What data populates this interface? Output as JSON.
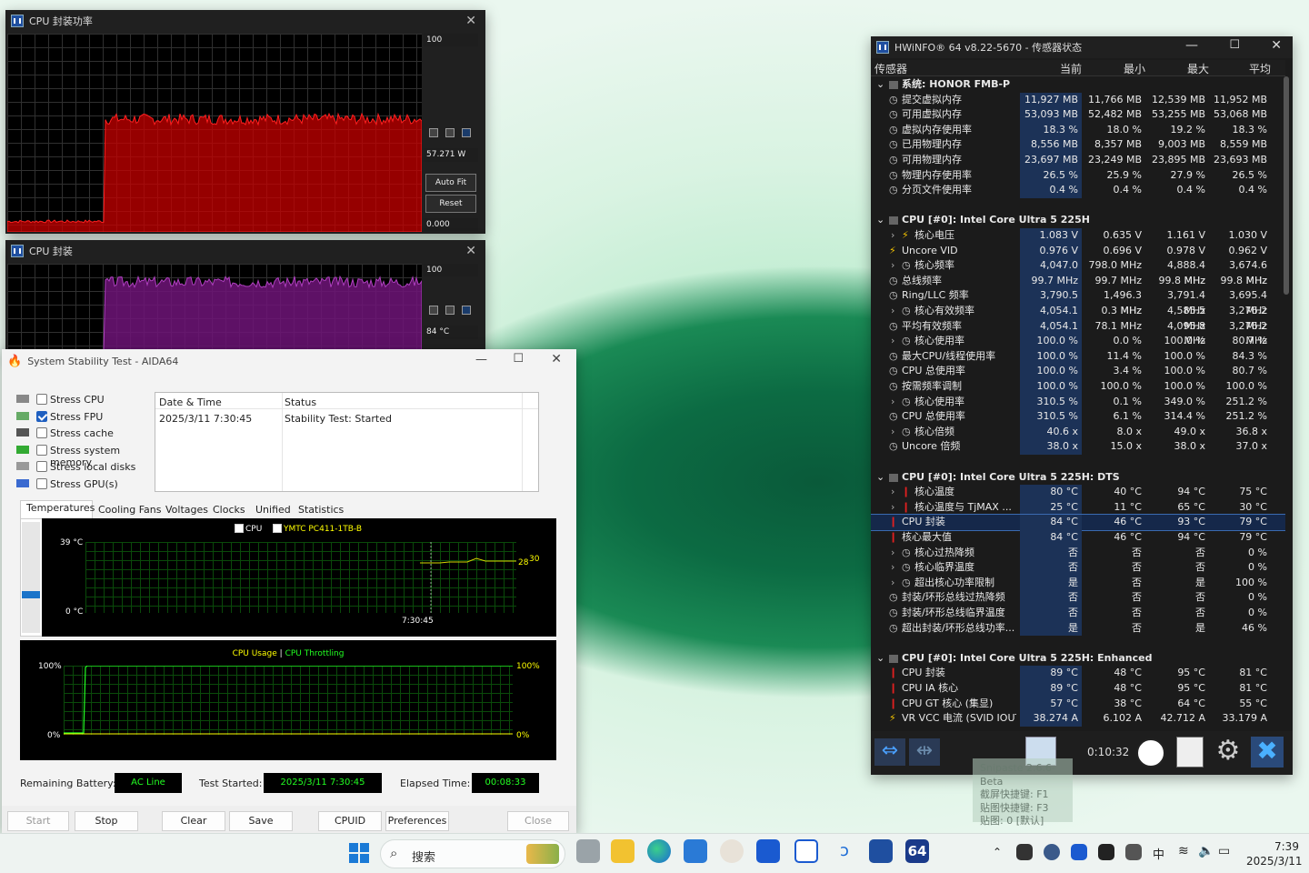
{
  "power_window": {
    "title": "CPU 封装功率",
    "scale_top": "100",
    "current": "57.271 W",
    "auto_fit": "Auto Fit",
    "reset": "Reset",
    "scale_bottom": "0.000"
  },
  "pkg_window": {
    "title": "CPU 封装",
    "scale_top": "100",
    "current": "84 °C"
  },
  "hwinfo": {
    "title": "HWiNFO® 64 v8.22-5670 - 传感器状态",
    "headers": {
      "sensor": "传感器",
      "current": "当前",
      "min": "最小",
      "max": "最大",
      "avg": "平均"
    },
    "rows": [
      {
        "type": "group",
        "name": "系统: HONOR FMB-P"
      },
      {
        "name": "提交虚拟内存",
        "cur": "11,927 MB",
        "min": "11,766 MB",
        "max": "12,539 MB",
        "avg": "11,952 MB"
      },
      {
        "name": "可用虚拟内存",
        "cur": "53,093 MB",
        "min": "52,482 MB",
        "max": "53,255 MB",
        "avg": "53,068 MB"
      },
      {
        "name": "虚拟内存使用率",
        "cur": "18.3 %",
        "min": "18.0 %",
        "max": "19.2 %",
        "avg": "18.3 %"
      },
      {
        "name": "已用物理内存",
        "cur": "8,556 MB",
        "min": "8,357 MB",
        "max": "9,003 MB",
        "avg": "8,559 MB"
      },
      {
        "name": "可用物理内存",
        "cur": "23,697 MB",
        "min": "23,249 MB",
        "max": "23,895 MB",
        "avg": "23,693 MB"
      },
      {
        "name": "物理内存使用率",
        "cur": "26.5 %",
        "min": "25.9 %",
        "max": "27.9 %",
        "avg": "26.5 %"
      },
      {
        "name": "分页文件使用率",
        "cur": "0.4 %",
        "min": "0.4 %",
        "max": "0.4 %",
        "avg": "0.4 %"
      },
      {
        "type": "blank"
      },
      {
        "type": "group",
        "name": "CPU [#0]: Intel Core Ultra 5 225H"
      },
      {
        "name": "核心电压",
        "cur": "1.083 V",
        "min": "0.635 V",
        "max": "1.161 V",
        "avg": "1.030 V",
        "exp": true,
        "icon": "bolt"
      },
      {
        "name": "Uncore VID",
        "cur": "0.976 V",
        "min": "0.696 V",
        "max": "0.978 V",
        "avg": "0.962 V",
        "icon": "bolt"
      },
      {
        "name": "核心频率",
        "cur": "4,047.0 MHz",
        "min": "798.0 MHz",
        "max": "4,888.4 MHz",
        "avg": "3,674.6 MHz",
        "exp": true
      },
      {
        "name": "总线频率",
        "cur": "99.7 MHz",
        "min": "99.7 MHz",
        "max": "99.8 MHz",
        "avg": "99.8 MHz"
      },
      {
        "name": "Ring/LLC 频率",
        "cur": "3,790.5 MHz",
        "min": "1,496.3 MHz",
        "max": "3,791.4 MHz",
        "avg": "3,695.4 MHz"
      },
      {
        "name": "核心有效频率",
        "cur": "4,054.1 MHz",
        "min": "0.3 MHz",
        "max": "4,585.5 MHz",
        "avg": "3,276.2 MHz",
        "exp": true
      },
      {
        "name": "平均有效频率",
        "cur": "4,054.1 MHz",
        "min": "78.1 MHz",
        "max": "4,095.8 MHz",
        "avg": "3,276.2 MHz"
      },
      {
        "name": "核心使用率",
        "cur": "100.0 %",
        "min": "0.0 %",
        "max": "100.0 %",
        "avg": "80.7 %",
        "exp": true
      },
      {
        "name": "最大CPU/线程使用率",
        "cur": "100.0 %",
        "min": "11.4 %",
        "max": "100.0 %",
        "avg": "84.3 %"
      },
      {
        "name": "CPU 总使用率",
        "cur": "100.0 %",
        "min": "3.4 %",
        "max": "100.0 %",
        "avg": "80.7 %"
      },
      {
        "name": "按需频率调制",
        "cur": "100.0 %",
        "min": "100.0 %",
        "max": "100.0 %",
        "avg": "100.0 %"
      },
      {
        "name": "核心使用率",
        "cur": "310.5 %",
        "min": "0.1 %",
        "max": "349.0 %",
        "avg": "251.2 %",
        "exp": true
      },
      {
        "name": "CPU 总使用率",
        "cur": "310.5 %",
        "min": "6.1 %",
        "max": "314.4 %",
        "avg": "251.2 %"
      },
      {
        "name": "核心倍频",
        "cur": "40.6 x",
        "min": "8.0 x",
        "max": "49.0 x",
        "avg": "36.8 x",
        "exp": true
      },
      {
        "name": "Uncore 倍频",
        "cur": "38.0 x",
        "min": "15.0 x",
        "max": "38.0 x",
        "avg": "37.0 x"
      },
      {
        "type": "blank"
      },
      {
        "type": "group",
        "name": "CPU [#0]: Intel Core Ultra 5 225H: DTS"
      },
      {
        "name": "核心温度",
        "cur": "80 °C",
        "min": "40 °C",
        "max": "94 °C",
        "avg": "75 °C",
        "exp": true,
        "icon": "temp"
      },
      {
        "name": "核心温度与 TjMAX ...",
        "cur": "25 °C",
        "min": "11 °C",
        "max": "65 °C",
        "avg": "30 °C",
        "exp": true,
        "icon": "temp"
      },
      {
        "name": "CPU 封装",
        "cur": "84 °C",
        "min": "46 °C",
        "max": "93 °C",
        "avg": "79 °C",
        "icon": "temp",
        "sel": true
      },
      {
        "name": "核心最大值",
        "cur": "84 °C",
        "min": "46 °C",
        "max": "94 °C",
        "avg": "79 °C",
        "icon": "temp"
      },
      {
        "name": "核心过热降频",
        "cur": "否",
        "min": "否",
        "max": "否",
        "avg": "0 %",
        "exp": true
      },
      {
        "name": "核心临界温度",
        "cur": "否",
        "min": "否",
        "max": "否",
        "avg": "0 %",
        "exp": true
      },
      {
        "name": "超出核心功率限制",
        "cur": "是",
        "min": "否",
        "max": "是",
        "avg": "100 %",
        "exp": true
      },
      {
        "name": "封装/环形总线过热降频",
        "cur": "否",
        "min": "否",
        "max": "否",
        "avg": "0 %"
      },
      {
        "name": "封装/环形总线临界温度",
        "cur": "否",
        "min": "否",
        "max": "否",
        "avg": "0 %"
      },
      {
        "name": "超出封装/环形总线功率...",
        "cur": "是",
        "min": "否",
        "max": "是",
        "avg": "46 %"
      },
      {
        "type": "blank"
      },
      {
        "type": "group",
        "name": "CPU [#0]: Intel Core Ultra 5 225H: Enhanced"
      },
      {
        "name": "CPU 封装",
        "cur": "89 °C",
        "min": "48 °C",
        "max": "95 °C",
        "avg": "81 °C",
        "icon": "temp"
      },
      {
        "name": "CPU IA 核心",
        "cur": "89 °C",
        "min": "48 °C",
        "max": "95 °C",
        "avg": "81 °C",
        "icon": "temp"
      },
      {
        "name": "CPU GT 核心 (集显)",
        "cur": "57 °C",
        "min": "38 °C",
        "max": "64 °C",
        "avg": "55 °C",
        "icon": "temp"
      },
      {
        "name": "VR VCC 电流 (SVID IOUT)",
        "cur": "38.274 A",
        "min": "6.102 A",
        "max": "42.712 A",
        "avg": "33.179 A",
        "icon": "bolt"
      }
    ],
    "timer": "0:10:32"
  },
  "snipaste": {
    "line1": "Snipaste 2.6.6-Beta",
    "line2": "截屏快捷键: F1",
    "line3": "贴图快捷键: F3",
    "line4": "贴图: 0 [默认]"
  },
  "aida": {
    "title": "System Stability Test - AIDA64",
    "stress": [
      {
        "label": "Stress CPU",
        "checked": false
      },
      {
        "label": "Stress FPU",
        "checked": true
      },
      {
        "label": "Stress cache",
        "checked": false
      },
      {
        "label": "Stress system memory",
        "checked": false
      },
      {
        "label": "Stress local disks",
        "checked": false
      },
      {
        "label": "Stress GPU(s)",
        "checked": false
      }
    ],
    "log_headers": {
      "date": "Date & Time",
      "status": "Status"
    },
    "log_row": {
      "date": "2025/3/11 7:30:45",
      "status": "Stability Test: Started"
    },
    "tabs": [
      "Temperatures",
      "Cooling Fans",
      "Voltages",
      "Clocks",
      "Unified",
      "Statistics"
    ],
    "temp_chart": {
      "legend_cpu": "CPU",
      "legend_disk": "YMTC PC411-1TB-B",
      "y_top": "39 °C",
      "y_bottom": "0 °C",
      "time": "7:30:45",
      "val1": "28",
      "val2": "30"
    },
    "usage_chart": {
      "legend_usage": "CPU Usage",
      "sep": "|",
      "legend_throttle": "CPU Throttling",
      "y_top": "100%",
      "y_bottom": "0%",
      "y_top_r": "100%",
      "y_bottom_r": "0%"
    },
    "status": {
      "battery_label": "Remaining Battery:",
      "battery": "AC Line",
      "started_label": "Test Started:",
      "started": "2025/3/11 7:30:45",
      "elapsed_label": "Elapsed Time:",
      "elapsed": "00:08:33"
    },
    "buttons": {
      "start": "Start",
      "stop": "Stop",
      "clear": "Clear",
      "save": "Save",
      "cpuid": "CPUID",
      "prefs": "Preferences",
      "close": "Close"
    }
  },
  "taskbar": {
    "search": "搜索",
    "ime": "中",
    "time": "7:39",
    "date": "2025/3/11",
    "app64": "64"
  }
}
